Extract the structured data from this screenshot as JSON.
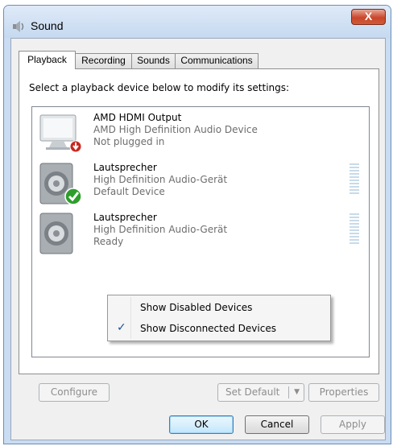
{
  "window": {
    "title": "Sound",
    "title_icon": "speaker-icon",
    "close_glyph": "X"
  },
  "tabs": [
    {
      "label": "Playback",
      "active": true
    },
    {
      "label": "Recording",
      "active": false
    },
    {
      "label": "Sounds",
      "active": false
    },
    {
      "label": "Communications",
      "active": false
    }
  ],
  "panel": {
    "instruction": "Select a playback device below to modify its settings:"
  },
  "devices": [
    {
      "name": "AMD HDMI Output",
      "description": "AMD High Definition Audio Device",
      "status": "Not plugged in",
      "icon": "monitor-icon",
      "badge": "red-down-arrow-badge"
    },
    {
      "name": "Lautsprecher",
      "description": "High Definition Audio-Gerät",
      "status": "Default Device",
      "icon": "speaker-icon",
      "badge": "green-check-badge"
    },
    {
      "name": "Lautsprecher",
      "description": "High Definition Audio-Gerät",
      "status": "Ready",
      "icon": "speaker-icon",
      "badge": ""
    }
  ],
  "context_menu": {
    "items": [
      {
        "label": "Show Disabled Devices",
        "checked": false
      },
      {
        "label": "Show Disconnected Devices",
        "checked": true
      }
    ],
    "check_glyph": "✓"
  },
  "buttons": {
    "configure": "Configure",
    "set_default": "Set Default",
    "set_default_arrow": "▼",
    "properties": "Properties",
    "ok": "OK",
    "cancel": "Cancel",
    "apply": "Apply"
  },
  "colors": {
    "title_bar": "#c5d9f0",
    "close_button": "#c9462c",
    "meter_bar": "#c7dbea",
    "check_mark": "#1f4f9a"
  }
}
